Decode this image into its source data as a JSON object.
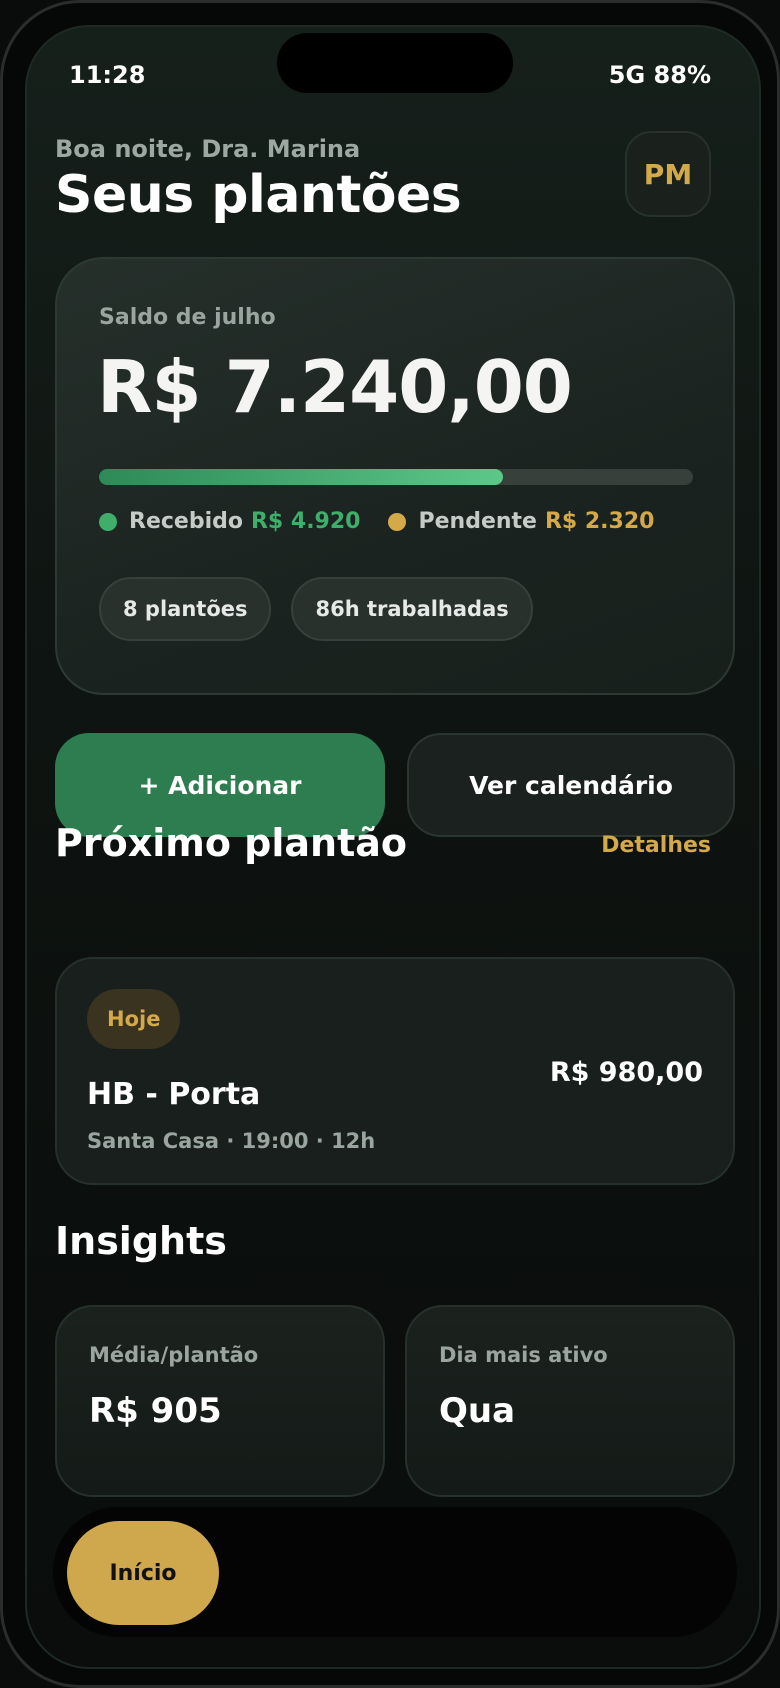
{
  "status_bar": {
    "time": "11:28",
    "indicators": "5G 88%"
  },
  "header": {
    "greeting": "Boa noite, Dra. Marina",
    "title": "Seus plantões",
    "avatar_initials": "PM"
  },
  "balance": {
    "label": "Saldo de julho",
    "amount": "R$ 7.240,00",
    "progress_fraction": 0.68,
    "received_label": "Recebido",
    "received_value": "R$ 4.920",
    "pending_label": "Pendente",
    "pending_value": "R$ 2.320",
    "chips": [
      "8 plantões",
      "86h trabalhadas"
    ]
  },
  "actions": {
    "add_label": "+ Adicionar",
    "calendar_label": "Ver calendário"
  },
  "next_shift": {
    "section_title": "Próximo plantão",
    "details_link": "Detalhes",
    "badge": "Hoje",
    "name": "HB - Porta",
    "meta": "Santa Casa · 19:00 · 12h",
    "value": "R$ 980,00"
  },
  "insights": {
    "section_title": "Insights",
    "cards": [
      {
        "label": "Média/plantão",
        "value": "R$ 905"
      },
      {
        "label": "Dia mais ativo",
        "value": "Qua"
      }
    ]
  },
  "tabbar": {
    "home_label": "Início"
  },
  "colors": {
    "accent_green": "#2e7d51",
    "received_green": "#3fae6b",
    "accent_gold": "#d4a94a",
    "background": "#0f1512"
  }
}
